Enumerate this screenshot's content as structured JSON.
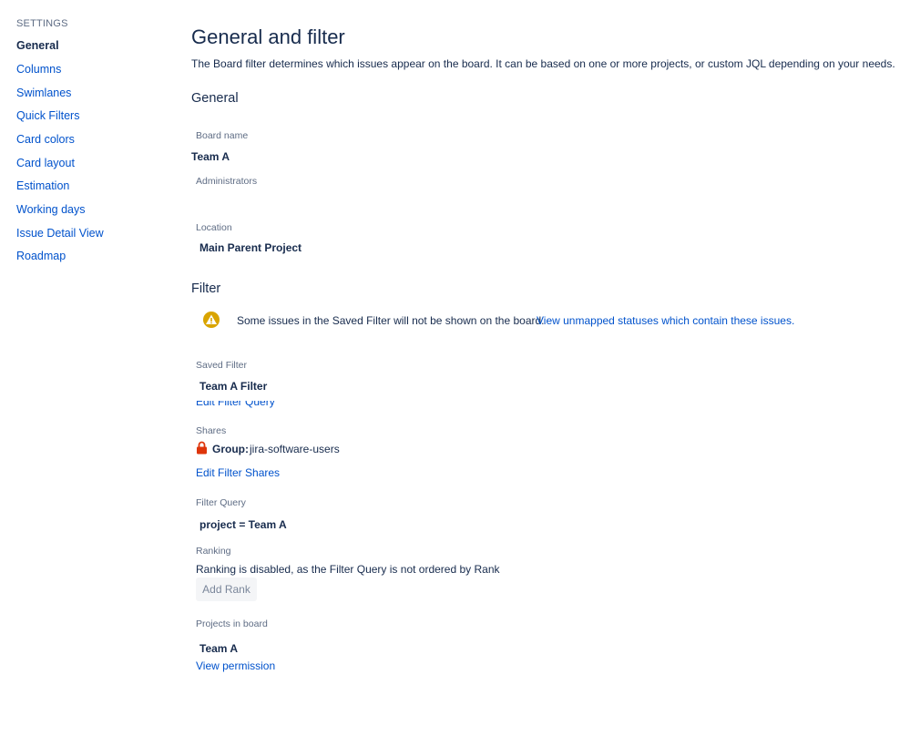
{
  "sidebar": {
    "heading": "SETTINGS",
    "items": [
      {
        "label": "General"
      },
      {
        "label": "Columns"
      },
      {
        "label": "Swimlanes"
      },
      {
        "label": "Quick Filters"
      },
      {
        "label": "Card colors"
      },
      {
        "label": "Card layout"
      },
      {
        "label": "Estimation"
      },
      {
        "label": "Working days"
      },
      {
        "label": "Issue Detail View"
      },
      {
        "label": "Roadmap"
      }
    ]
  },
  "main": {
    "title": "General and filter",
    "description": "The Board filter determines which issues appear on the board. It can be based on one or more projects, or custom JQL depending on your needs.",
    "general": {
      "section_title": "General",
      "board_name_label": "Board name",
      "board_name_value": "Team A",
      "administrators_label": "Administrators",
      "location_label": "Location",
      "location_value": "Main Parent Project"
    },
    "filter": {
      "section_title": "Filter",
      "warning_text": "Some issues in the Saved Filter will not be shown on the board.",
      "warning_link": "View unmapped statuses which contain these issues.",
      "saved_filter_label": "Saved Filter",
      "saved_filter_value": "Team A Filter",
      "edit_filter_query_link": "Edit Filter Query",
      "shares_label": "Shares",
      "shares_group_prefix": "Group:",
      "shares_group_value": "jira-software-users",
      "edit_filter_shares_link": "Edit Filter Shares",
      "filter_query_label": "Filter Query",
      "filter_query_value": "project = Team A",
      "ranking_label": "Ranking",
      "ranking_text": "Ranking is disabled, as the Filter Query is not ordered by Rank",
      "add_rank_button": "Add Rank",
      "projects_label": "Projects in board",
      "projects_value": "Team A",
      "view_permission_link": "View permission"
    }
  },
  "colors": {
    "link": "#0052cc",
    "text": "#172b4d",
    "muted": "#5e6c84",
    "warning": "#d9a400",
    "lock": "#de350b"
  },
  "icons": {
    "warning": "warning-icon",
    "lock": "lock-icon"
  }
}
